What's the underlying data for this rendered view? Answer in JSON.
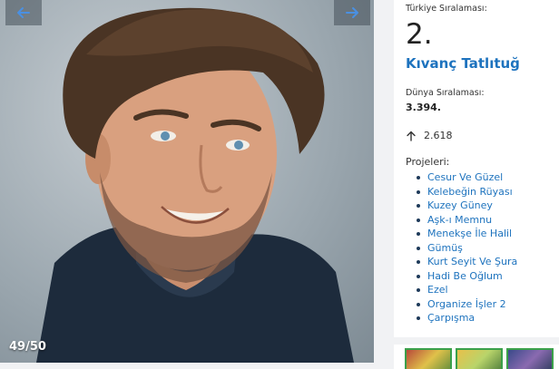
{
  "gallery": {
    "counter": "49/50",
    "prev_icon": "arrow-left-icon",
    "next_icon": "arrow-right-icon"
  },
  "info": {
    "turkey_rank_label": "Türkiye Sıralaması:",
    "turkey_rank": "2.",
    "name": "Kıvanç Tatlıtuğ",
    "world_rank_label": "Dünya Sıralaması:",
    "world_rank": "3.394.",
    "trend_icon": "arrow-up-icon",
    "trend_value": "2.618",
    "projects_label": "Projeleri:",
    "projects": [
      "Cesur Ve Güzel",
      "Kelebeğin Rüyası",
      "Kuzey Güney",
      "Aşk-ı Memnu",
      "Menekşe İle Halil",
      "Gümüş",
      "Kurt Seyit Ve Şura",
      "Hadi Be Oğlum",
      "Ezel",
      "Organize İşler 2",
      "Çarpışma"
    ]
  },
  "colors": {
    "link": "#1e73be",
    "thumb_border": "#3aa04a"
  }
}
